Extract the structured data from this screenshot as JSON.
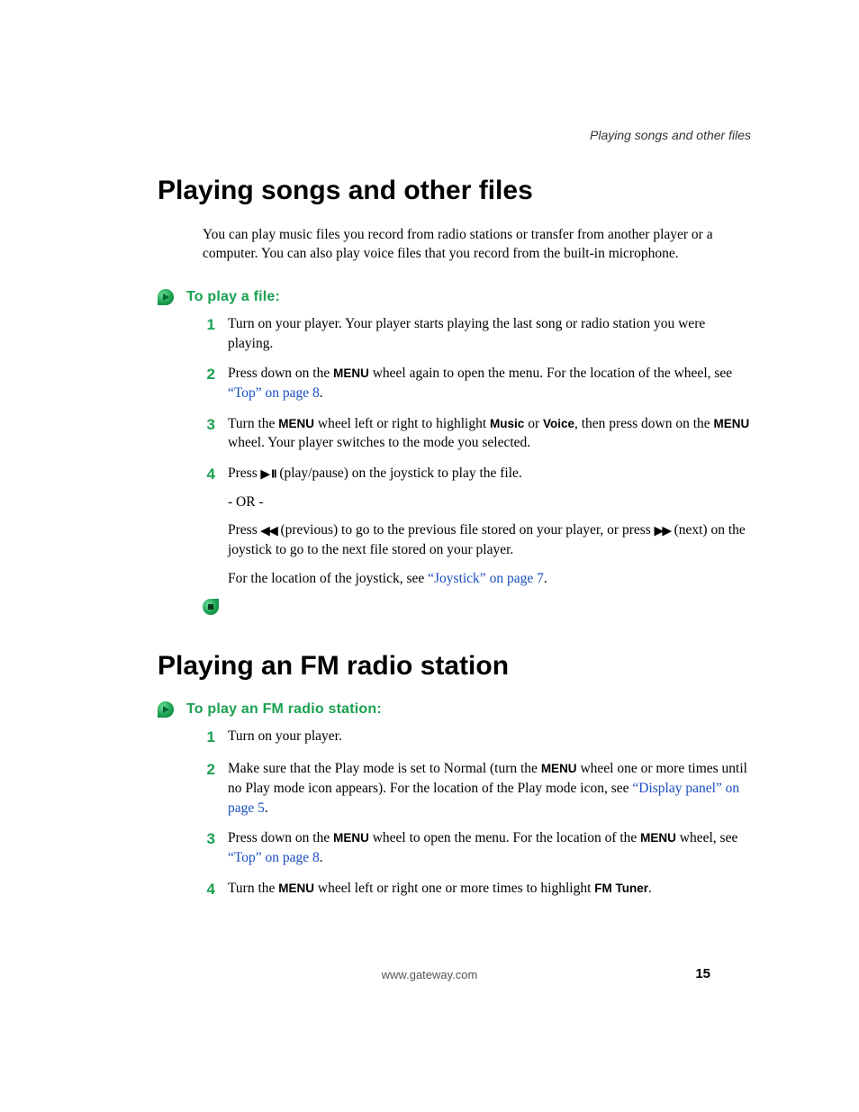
{
  "running_head": "Playing songs and other files",
  "section1": {
    "title": "Playing songs and other files",
    "intro": "You can play music files you record from radio stations or transfer from another player or a computer. You can also play voice files that you record from the built-in microphone.",
    "proc_title": "To play a file:",
    "steps": {
      "s1": "Turn on your player. Your player starts playing the last song or radio station you were playing.",
      "s2a": "Press down on the ",
      "s2_menu": "MENU",
      "s2b": " wheel again to open the menu. For the location of the wheel, see ",
      "s2_link": "“Top” on page 8",
      "s2c": ".",
      "s3a": "Turn the ",
      "s3_menu1": "MENU",
      "s3b": " wheel left or right to highlight ",
      "s3_music": "Music",
      "s3c": " or ",
      "s3_voice": "Voice",
      "s3d": ", then press down on the ",
      "s3_menu2": "MENU",
      "s3e": " wheel. Your player switches to the mode you selected.",
      "s4a": "Press ",
      "s4b": " (play/pause) on the joystick to play the file.",
      "s4_or": "- OR -",
      "s4c": "Press ",
      "s4d": " (previous) to go to the previous file stored on your player, or press ",
      "s4e": " (next) on the joystick to go to the next file stored on your player.",
      "s4f": "For the location of the joystick, see ",
      "s4_link": "“Joystick” on page 7",
      "s4g": "."
    }
  },
  "section2": {
    "title": "Playing an FM radio station",
    "proc_title": "To play an FM radio station:",
    "steps": {
      "s1": "Turn on your player.",
      "s2a": "Make sure that the Play mode is set to Normal (turn the ",
      "s2_menu": "MENU",
      "s2b": " wheel one or more times until no Play mode icon appears). For the location of the Play mode icon, see ",
      "s2_link": "“Display panel” on page 5",
      "s2c": ".",
      "s3a": "Press down on the ",
      "s3_menu1": "MENU",
      "s3b": " wheel to open the menu. For the location of the ",
      "s3_menu2": "MENU",
      "s3c": " wheel, see ",
      "s3_link": "“Top” on page 8",
      "s3d": ".",
      "s4a": "Turn the ",
      "s4_menu": "MENU",
      "s4b": " wheel left or right one or more times to highlight ",
      "s4_fm": "FM Tuner",
      "s4c": "."
    }
  },
  "footer_url": "www.gateway.com",
  "page_number": "15"
}
